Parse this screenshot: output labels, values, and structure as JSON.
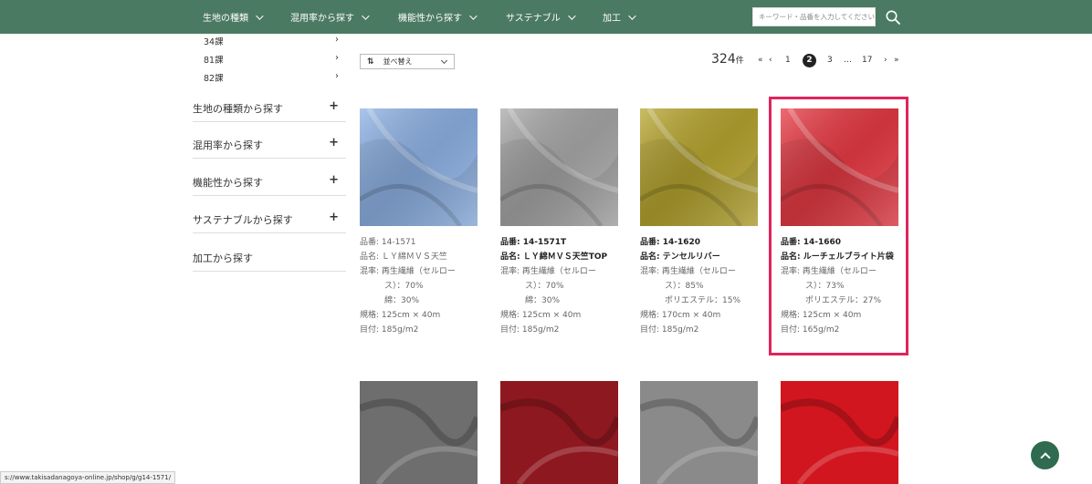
{
  "nav": {
    "items": [
      {
        "label": "生地の種類"
      },
      {
        "label": "混用率から探す"
      },
      {
        "label": "機能性から探す"
      },
      {
        "label": "サステナブル"
      },
      {
        "label": "加工"
      }
    ],
    "search_placeholder": "キーワード・品番を入力してください",
    "brand_color": "#4b7a62"
  },
  "sidebar": {
    "sub_items": [
      {
        "label": "34課",
        "arrow": "›"
      },
      {
        "label": "81課",
        "arrow": "›"
      },
      {
        "label": "82課",
        "arrow": "›"
      }
    ],
    "sections": [
      {
        "label": "生地の種類から探す",
        "icon": "+"
      },
      {
        "label": "混用率から探す",
        "icon": "+"
      },
      {
        "label": "機能性から探す",
        "icon": "+"
      },
      {
        "label": "サステナブルから探す",
        "icon": "+"
      },
      {
        "label": "加工から探す",
        "icon": ""
      }
    ]
  },
  "toolbar": {
    "sort_label": "並べ替え",
    "count": "324",
    "count_unit": "件"
  },
  "pagination": {
    "first": "«",
    "prev": "‹",
    "pages": [
      "1",
      "2",
      "3",
      "…",
      "17"
    ],
    "current": "2",
    "next": "›",
    "last": "»"
  },
  "products": [
    {
      "id_label": "品番: 14-1571",
      "name_label": "品名: ＬＹ綿ＭＶＳ天竺",
      "blend_label": "混率: 再生繊維（セルロー",
      "blend_cont": [
        "ス）：70%",
        "綿：30%"
      ],
      "size_label": "規格: 125cm × 40m",
      "weight_label": "目付: 185g/m2",
      "bold": false,
      "color": "#8fb3e6"
    },
    {
      "id_label": "品番: 14-1571T",
      "name_label": "品名: ＬＹ綿ＭＶＳ天竺TOP",
      "blend_label": "混率: 再生繊維（セルロー",
      "blend_cont": [
        "ス）：70%",
        "綿：30%"
      ],
      "size_label": "規格: 125cm × 40m",
      "weight_label": "目付: 185g/m2",
      "bold": true,
      "color": "#a9a9a9"
    },
    {
      "id_label": "品番: 14-1620",
      "name_label": "品名: テンセルリバー",
      "blend_label": "混率: 再生繊維（セルロー",
      "blend_cont": [
        "ス）：85%",
        "ポリエステル：15%"
      ],
      "size_label": "規格: 170cm × 40m",
      "weight_label": "目付: 185g/m2",
      "bold": true,
      "color": "#b8a630"
    },
    {
      "id_label": "品番: 14-1660",
      "name_label": "品名: ルーチェルブライト片袋",
      "blend_label": "混率: 再生繊維（セルロー",
      "blend_cont": [
        "ス）：73%",
        "ポリエステル：27%"
      ],
      "size_label": "規格: 125cm × 40m",
      "weight_label": "目付: 165g/m2",
      "bold": true,
      "color": "#e83a44"
    }
  ],
  "row2_colors": [
    "#6e6e6e",
    "#8e1820",
    "#8a8a8a",
    "#d1161f"
  ],
  "status_url": "s://www.takisadanagoya-online.jp/shop/g/g14-1571/"
}
